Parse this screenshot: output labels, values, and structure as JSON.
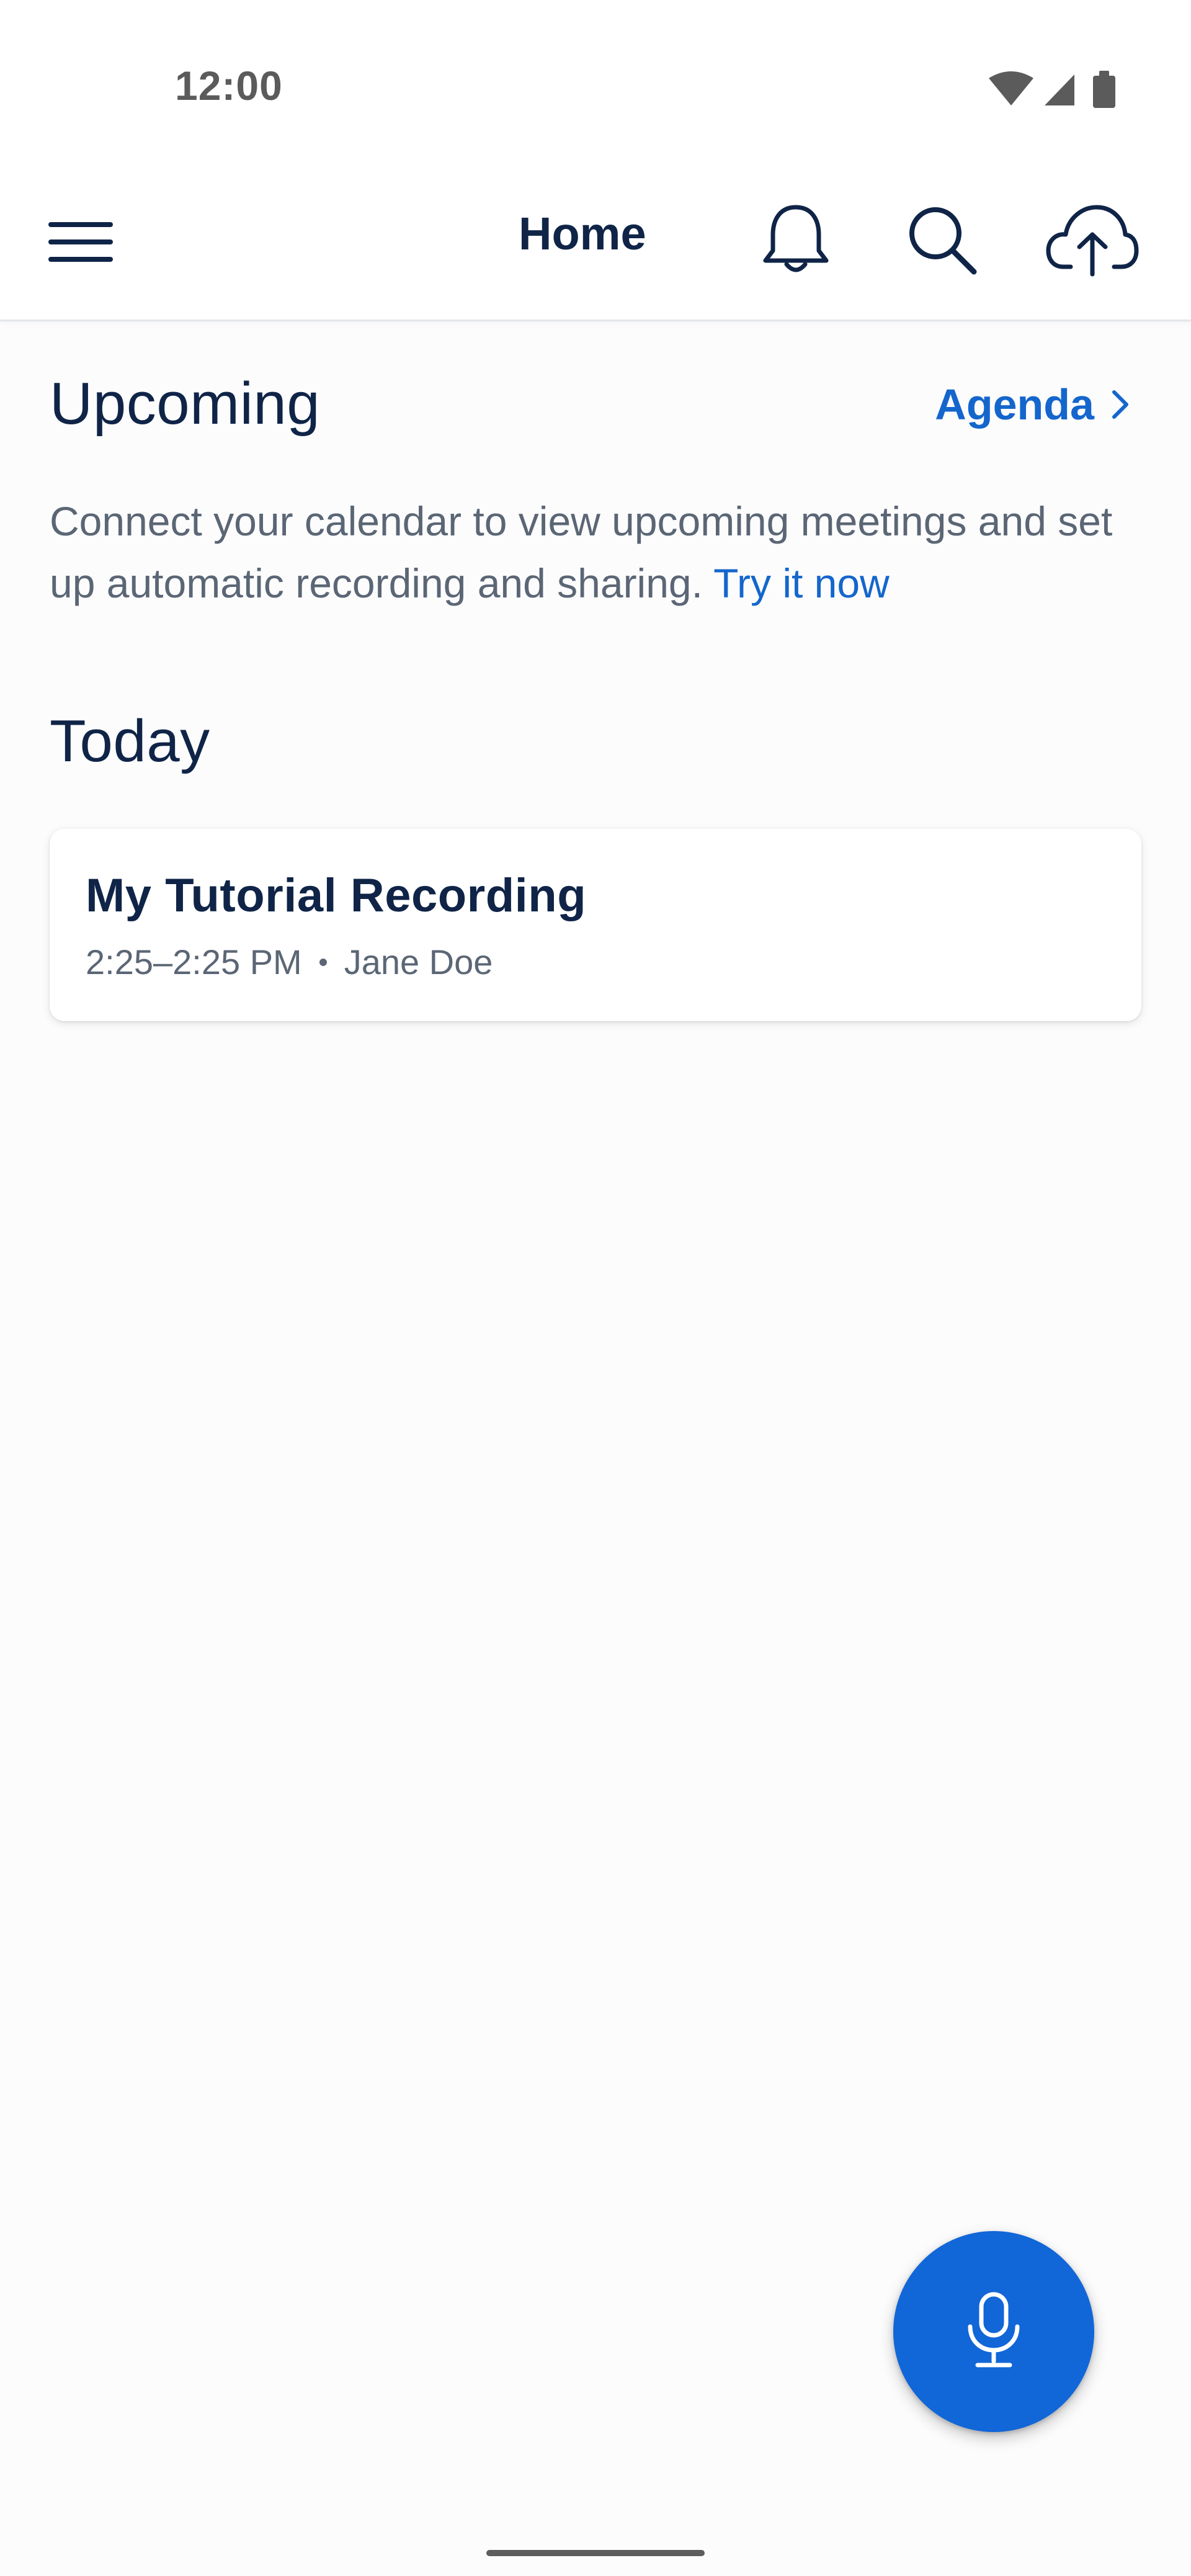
{
  "status_bar": {
    "time": "12:00",
    "icons": [
      "wifi-icon",
      "cellular-signal-icon",
      "battery-icon"
    ]
  },
  "app_bar": {
    "title": "Home",
    "icons": [
      "menu-icon",
      "bell-icon",
      "search-icon",
      "cloud-upload-icon"
    ]
  },
  "upcoming": {
    "title": "Upcoming",
    "agenda_label": "Agenda",
    "connect_text": "Connect your calendar to view upcoming meetings and set up automatic recording and sharing.",
    "try_link": "Try it now"
  },
  "today": {
    "title": "Today",
    "recordings": [
      {
        "title": "My Tutorial Recording",
        "time": "2:25–2:25 PM",
        "owner": "Jane Doe"
      }
    ]
  },
  "fab": {
    "icon": "microphone-icon"
  },
  "colors": {
    "accent": "#1466cc",
    "fab": "#1166d8",
    "text_primary": "#0f2447",
    "text_secondary": "#5b6675"
  }
}
